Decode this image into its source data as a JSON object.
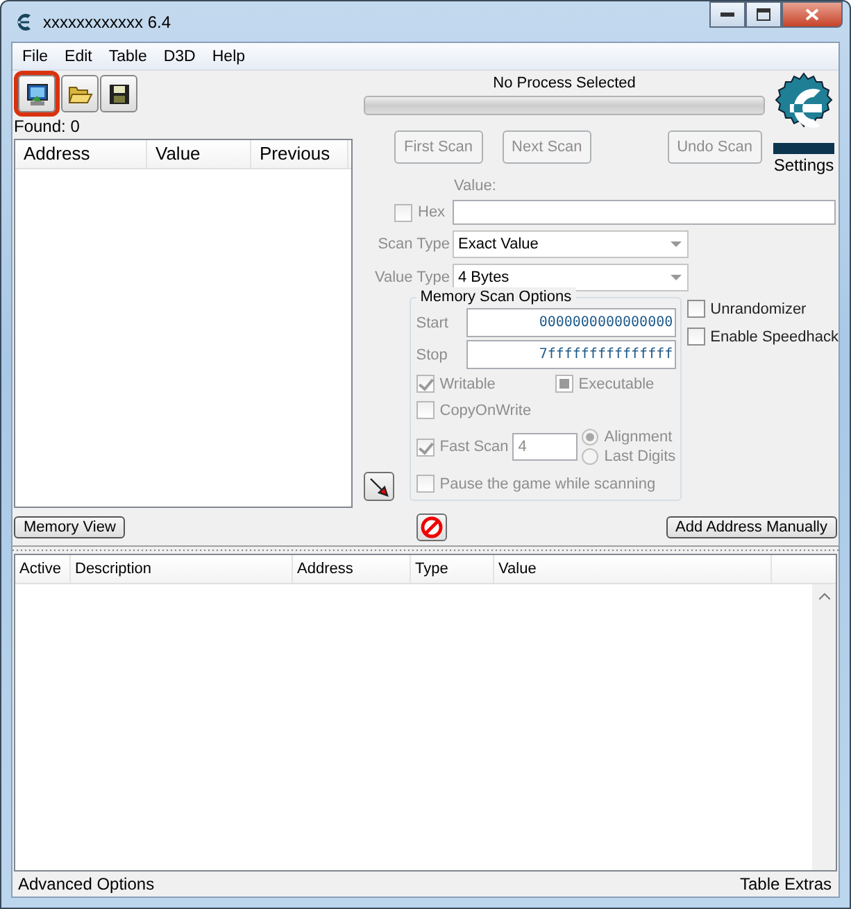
{
  "window": {
    "title": "xxxxxxxxxxxx 6.4"
  },
  "menu": [
    "File",
    "Edit",
    "Table",
    "D3D",
    "Help"
  ],
  "toolbar": [
    {
      "kind": "process",
      "highlighted": true
    },
    {
      "kind": "open",
      "highlighted": false
    },
    {
      "kind": "save",
      "highlighted": false
    }
  ],
  "process": {
    "label": "No Process Selected",
    "level": 0
  },
  "found": "Found: 0",
  "results_columns": [
    "Address",
    "Value",
    "Previous"
  ],
  "scan_buttons": [
    {
      "label": "First Scan",
      "disabled": true
    },
    {
      "label": "Next Scan",
      "disabled": true
    },
    {
      "label": "Undo Scan",
      "disabled": true
    }
  ],
  "settings_label": "Settings",
  "value_label": "Value:",
  "hex": {
    "label": "Hex",
    "checked": false,
    "disabled": true
  },
  "scan_type": {
    "label": "Scan Type",
    "value": "Exact Value"
  },
  "value_type": {
    "label": "Value Type",
    "value": "4 Bytes"
  },
  "memory_scan_options": {
    "title": "Memory Scan Options",
    "start_label": "Start",
    "start": "0000000000000000",
    "stop_label": "Stop",
    "stop": "7fffffffffffffff",
    "writable": {
      "label": "Writable",
      "checked": true,
      "disabled": true
    },
    "executable": {
      "label": "Executable",
      "checked": false,
      "indeterminate": true,
      "disabled": true
    },
    "copy_on_write": {
      "label": "CopyOnWrite",
      "checked": false,
      "disabled": true
    },
    "fast_scan": {
      "label": "Fast Scan",
      "checked": true,
      "disabled": true,
      "value": "4"
    },
    "alignment": [
      {
        "label": "Alignment",
        "selected": true
      },
      {
        "label": "Last Digits",
        "selected": false
      }
    ],
    "pause": {
      "label": "Pause the game while scanning",
      "checked": false,
      "disabled": true
    }
  },
  "extra_options": [
    {
      "label": "Unrandomizer",
      "checked": false,
      "disabled": false
    },
    {
      "label": "Enable Speedhack",
      "checked": false,
      "disabled": false
    }
  ],
  "memory_view_button": "Memory View",
  "add_address_button": "Add Address Manually",
  "address_list_columns": [
    "Active",
    "Description",
    "Address",
    "Type",
    "Value"
  ],
  "footer": {
    "left": "Advanced Options",
    "right": "Table Extras"
  }
}
